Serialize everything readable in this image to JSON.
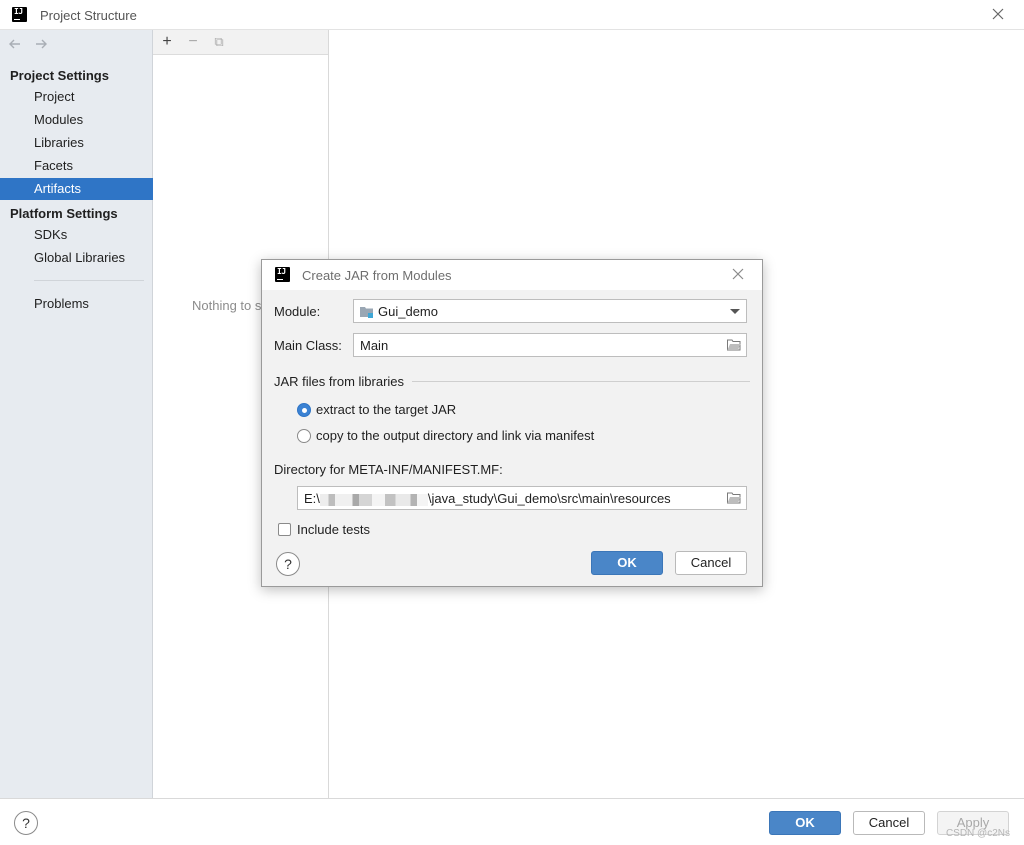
{
  "window": {
    "title": "Project Structure",
    "app_icon_text": "IJ"
  },
  "sidebar": {
    "project_settings_header": "Project Settings",
    "project_settings_items": [
      {
        "label": "Project",
        "selected": false
      },
      {
        "label": "Modules",
        "selected": false
      },
      {
        "label": "Libraries",
        "selected": false
      },
      {
        "label": "Facets",
        "selected": false
      },
      {
        "label": "Artifacts",
        "selected": true
      }
    ],
    "platform_settings_header": "Platform Settings",
    "platform_settings_items": [
      {
        "label": "SDKs"
      },
      {
        "label": "Global Libraries"
      }
    ],
    "problems_label": "Problems",
    "selected_color": "#2f75c6"
  },
  "middle_panel": {
    "toolbar": {
      "add": "+",
      "remove": "−",
      "copy": "⧉"
    },
    "empty_text": "Nothing to show"
  },
  "dialog": {
    "title": "Create JAR from Modules",
    "module_label": "Module:",
    "module_value": "Gui_demo",
    "main_class_label": "Main Class:",
    "main_class_value": "Main",
    "jar_group_title": "JAR files from libraries",
    "radio_extract": "extract to the target JAR",
    "radio_copy": "copy to the output directory and link via manifest",
    "selected_option": "extract",
    "manifest_dir_label": "Directory for META-INF/MANIFEST.MF:",
    "manifest_dir_prefix": "E:\\",
    "manifest_dir_suffix": "\\java_study\\Gui_demo\\src\\main\\resources",
    "include_tests_label": "Include tests",
    "include_tests_checked": false,
    "ok_label": "OK",
    "cancel_label": "Cancel",
    "help_label": "?"
  },
  "bottom_bar": {
    "help_label": "?",
    "ok_label": "OK",
    "cancel_label": "Cancel",
    "apply_label": "Apply",
    "watermark": "CSDN @c2Ns"
  },
  "colors": {
    "primary_button": "#4a86c8",
    "sidebar_bg": "#e7ebf0",
    "dialog_bg": "#f2f2f2"
  }
}
